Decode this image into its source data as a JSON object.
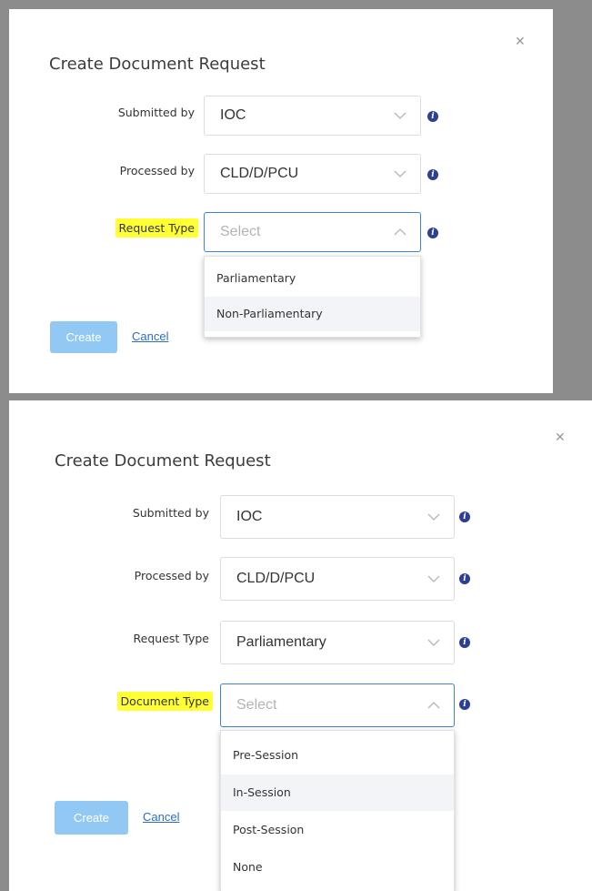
{
  "dialog1": {
    "title": "Create Document Request",
    "close_icon": "close-icon",
    "fields": {
      "submitted_by": {
        "label": "Submitted by",
        "value": "IOC"
      },
      "processed_by": {
        "label": "Processed by",
        "value": "CLD/D/PCU"
      },
      "request_type": {
        "label": "Request Type",
        "placeholder": "Select",
        "expanded": true
      }
    },
    "dropdown_options": [
      "Parliamentary",
      "Non-Parliamentary"
    ],
    "hovered_option": "Non-Parliamentary",
    "create_label": "Create",
    "cancel_label": "Cancel"
  },
  "dialog2": {
    "title": "Create Document Request",
    "close_icon": "close-icon",
    "fields": {
      "submitted_by": {
        "label": "Submitted by",
        "value": "IOC"
      },
      "processed_by": {
        "label": "Processed by",
        "value": "CLD/D/PCU"
      },
      "request_type": {
        "label": "Request Type",
        "value": "Parliamentary"
      },
      "document_type": {
        "label": "Document Type",
        "placeholder": "Select",
        "expanded": true
      }
    },
    "dropdown_options": [
      "Pre-Session",
      "In-Session",
      "Post-Session",
      "None"
    ],
    "hovered_option": "In-Session",
    "create_label": "Create",
    "cancel_label": "Cancel"
  },
  "icons": {
    "info": "info-icon",
    "chevron_down": "chevron-down-icon",
    "chevron_up": "chevron-up-icon"
  },
  "info_glyph": "i",
  "colors": {
    "highlight": "#ffff33",
    "primary_button": "#92c9f4",
    "link": "#2c6fbd",
    "info_icon": "#2d3f93",
    "focus_border": "#3b84d0"
  }
}
